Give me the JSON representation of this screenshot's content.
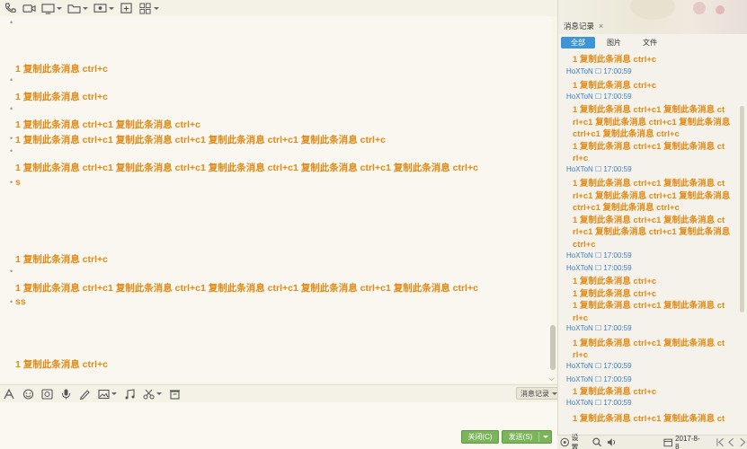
{
  "toolbar_icons": [
    "phone-icon",
    "video-icon",
    "screen-share-icon",
    "folder-icon",
    "remote-desktop-icon",
    "add-window-icon",
    "apps-grid-icon"
  ],
  "chat": {
    "messages": [
      "1 复制此条消息 ctrl+c",
      "1 复制此条消息 ctrl+c",
      "1 复制此条消息 ctrl+c1 复制此条消息 ctrl+c",
      "1 复制此条消息 ctrl+c1 复制此条消息 ctrl+c1 复制此条消息 ctrl+c1 复制此条消息 ctrl+c",
      "1 复制此条消息 ctrl+c1 复制此条消息 ctrl+c1 复制此条消息 ctrl+c1 复制此条消息 ctrl+c1 复制此条消息 ctrl+c",
      "s",
      "1 复制此条消息 ctrl+c",
      "1 复制此条消息 ctrl+c1 复制此条消息 ctrl+c1 复制此条消息 ctrl+c1 复制此条消息 ctrl+c1 复制此条消息 ctrl+c",
      "ss",
      "1 复制此条消息 ctrl+c"
    ]
  },
  "edit_toolbar_icons": [
    "font-icon",
    "emoji-icon",
    "gif-icon",
    "voice-icon",
    "handwriting-icon",
    "image-icon",
    "music-icon",
    "screenshot-icon",
    "history-clear-icon"
  ],
  "history_button": "消息记录",
  "buttons": {
    "close": "关闭(C)",
    "send": "发送(S)"
  },
  "panel": {
    "title": "消息记录",
    "close": "×",
    "tabs": [
      "全部",
      "图片",
      "文件"
    ],
    "active_tab": "全部",
    "history": [
      {
        "type": "text",
        "value": "1 复制此条消息 ctrl+c"
      },
      {
        "type": "meta",
        "value": "HoXToN ☐ 17:00:59"
      },
      {
        "type": "text",
        "value": "1 复制此条消息 ctrl+c"
      },
      {
        "type": "meta",
        "value": "HoXToN ☐ 17:00:59"
      },
      {
        "type": "text",
        "value": "1 复制此条消息 ctrl+c1 复制此条消息 ct"
      },
      {
        "type": "text",
        "value": "rl+c1 复制此条消息 ctrl+c1 复制此条消息"
      },
      {
        "type": "text",
        "value": "ctrl+c1 复制此条消息 ctrl+c"
      },
      {
        "type": "text",
        "value": "1 复制此条消息 ctrl+c1 复制此条消息 ct"
      },
      {
        "type": "text",
        "value": "rl+c"
      },
      {
        "type": "meta",
        "value": "HoXToN ☐ 17:00:59"
      },
      {
        "type": "text",
        "value": "1 复制此条消息 ctrl+c1 复制此条消息 ct"
      },
      {
        "type": "text",
        "value": "rl+c1 复制此条消息 ctrl+c1 复制此条消息"
      },
      {
        "type": "text",
        "value": "ctrl+c1 复制此条消息 ctrl+c"
      },
      {
        "type": "text",
        "value": "1 复制此条消息 ctrl+c1 复制此条消息 ct"
      },
      {
        "type": "text",
        "value": "rl+c1 复制此条消息 ctrl+c1 复制此条消息"
      },
      {
        "type": "text",
        "value": "ctrl+c"
      },
      {
        "type": "meta",
        "value": "HoXToN ☐ 17:00:59"
      },
      {
        "type": "meta",
        "value": "HoXToN ☐ 17:00:59"
      },
      {
        "type": "text",
        "value": "1 复制此条消息 ctrl+c"
      },
      {
        "type": "text",
        "value": "1 复制此条消息 ctrl+c"
      },
      {
        "type": "text",
        "value": "1 复制此条消息 ctrl+c1 复制此条消息 ct"
      },
      {
        "type": "text",
        "value": "rl+c"
      },
      {
        "type": "meta",
        "value": "HoXToN ☐ 17:00:59"
      },
      {
        "type": "text",
        "value": "1 复制此条消息 ctrl+c1 复制此条消息 ct"
      },
      {
        "type": "text",
        "value": "rl+c"
      },
      {
        "type": "meta",
        "value": "HoXToN ☐ 17:00:59"
      },
      {
        "type": "meta",
        "value": "HoXToN ☐ 17:00:59"
      },
      {
        "type": "text",
        "value": "1 复制此条消息 ctrl+c"
      },
      {
        "type": "meta",
        "value": "HoXToN ☐ 17:00:59"
      },
      {
        "type": "text",
        "value": "1 复制此条消息 ctrl+c1 复制此条消息 ct"
      }
    ]
  },
  "footer": {
    "settings": "设置",
    "date": "2017-8-8"
  },
  "colors": {
    "message": "#e08a17",
    "sender": "#3a7ec2",
    "accent_tab": "#3d95d8",
    "button_green": "#7ab55c"
  }
}
